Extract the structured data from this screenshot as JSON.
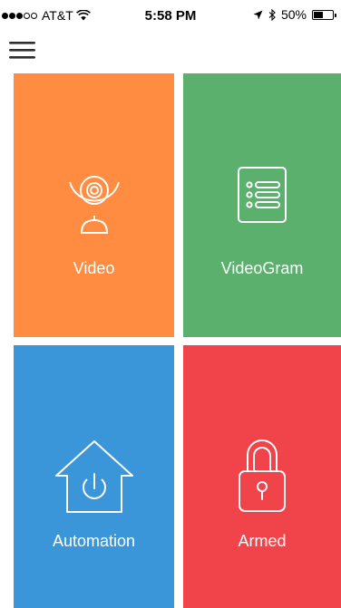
{
  "status_bar": {
    "carrier": "AT&T",
    "time": "5:58 PM",
    "battery": "50%",
    "battery_level": 0.5
  },
  "nav": {
    "menu_icon": "hamburger-menu-icon"
  },
  "tiles": [
    {
      "label": "Video",
      "color": "#FF8C40",
      "icon": "webcam-icon"
    },
    {
      "label": "VideoGram",
      "color": "#5BB06D",
      "icon": "list-document-icon"
    },
    {
      "label": "Automation",
      "color": "#3A95D9",
      "icon": "home-power-icon"
    },
    {
      "label": "Armed",
      "color": "#F0444A",
      "icon": "padlock-icon"
    }
  ]
}
